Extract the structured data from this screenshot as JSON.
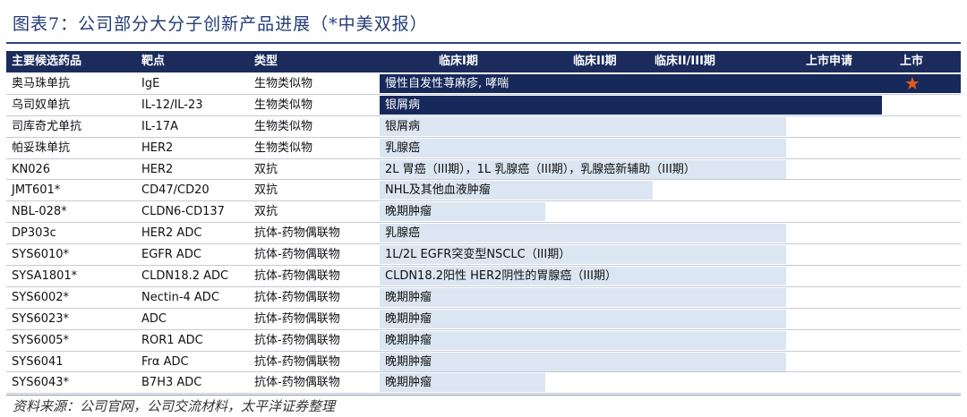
{
  "title": "图表7：公司部分大分子创新产品进展（*中美双报）",
  "header": {
    "drug": "主要候选药品",
    "target": "靶点",
    "type": "类型",
    "phase1": "临床I期",
    "phase2": "临床II期",
    "phase3": "临床II/III期",
    "filing": "上市申请",
    "launched": "上市"
  },
  "colors": {
    "header_bg": "#1a2b5c",
    "bar_light": "#dce6f2",
    "bar_dark": "#17285a",
    "star": "#e25a1c"
  },
  "rows": [
    {
      "drug": "奥马珠单抗",
      "target": "IgE",
      "type": "生物类似物",
      "indication": "慢性自发性荨麻疹, 哮喘",
      "stage": "上市",
      "progress": 1.0,
      "style": "dark",
      "star": "★"
    },
    {
      "drug": "乌司奴单抗",
      "target": "IL-12/IL-23",
      "type": "生物类似物",
      "indication": "银屑病",
      "stage": "上市申请",
      "progress": 0.865,
      "style": "dark"
    },
    {
      "drug": "司库奇尤单抗",
      "target": "IL-17A",
      "type": "生物类似物",
      "indication": "银屑病",
      "stage": "临床III期",
      "progress": 0.7,
      "style": "light"
    },
    {
      "drug": "帕妥珠单抗",
      "target": "HER2",
      "type": "生物类似物",
      "indication": "乳腺癌",
      "stage": "临床III期",
      "progress": 0.7,
      "style": "light"
    },
    {
      "drug": "KN026",
      "target": "HER2",
      "type": "双抗",
      "indication": "2L 胃癌（III期），1L 乳腺癌（III期），乳腺癌新辅助（III期）",
      "stage": "临床III期",
      "progress": 0.7,
      "style": "light"
    },
    {
      "drug": "JMT601*",
      "target": "CD47/CD20",
      "type": "双抗",
      "indication": "NHL及其他血液肿瘤",
      "stage": "临床I期",
      "progress": 0.47,
      "style": "light"
    },
    {
      "drug": "NBL-028*",
      "target": "CLDN6-CD137",
      "type": "双抗",
      "indication": "晚期肿瘤",
      "stage": "临床I期",
      "progress": 0.285,
      "style": "light"
    },
    {
      "drug": "DP303c",
      "target": "HER2 ADC",
      "type": "抗体-药物偶联物",
      "indication": "乳腺癌",
      "stage": "临床III期",
      "progress": 0.7,
      "style": "light"
    },
    {
      "drug": "SYS6010*",
      "target": "EGFR ADC",
      "type": "抗体-药物偶联物",
      "indication": "1L/2L EGFR突变型NSCLC（III期）",
      "stage": "临床III期",
      "progress": 0.7,
      "style": "light"
    },
    {
      "drug": "SYSA1801*",
      "target": "CLDN18.2 ADC",
      "type": "抗体-药物偶联物",
      "indication": "CLDN18.2阳性 HER2阴性的胃腺癌（III期）",
      "stage": "临床III期",
      "progress": 0.7,
      "style": "light"
    },
    {
      "drug": "SYS6002*",
      "target": "Nectin-4 ADC",
      "type": "抗体-药物偶联物",
      "indication": "晚期肿瘤",
      "stage": "临床III期",
      "progress": 0.7,
      "style": "light"
    },
    {
      "drug": "SYS6023*",
      "target": "ADC",
      "type": "抗体-药物偶联物",
      "indication": "晚期肿瘤",
      "stage": "临床III期",
      "progress": 0.7,
      "style": "light"
    },
    {
      "drug": "SYS6005*",
      "target": "ROR1 ADC",
      "type": "抗体-药物偶联物",
      "indication": "晚期肿瘤",
      "stage": "临床III期",
      "progress": 0.7,
      "style": "light"
    },
    {
      "drug": "SYS6041",
      "target": "Frα ADC",
      "type": "抗体-药物偶联物",
      "indication": "晚期肿瘤",
      "stage": "临床III期",
      "progress": 0.7,
      "style": "light"
    },
    {
      "drug": "SYS6043*",
      "target": "B7H3 ADC",
      "type": "抗体-药物偶联物",
      "indication": "晚期肿瘤",
      "stage": "临床I期",
      "progress": 0.285,
      "style": "light"
    }
  ],
  "source": "资料来源：公司官网，公司交流材料，太平洋证券整理"
}
